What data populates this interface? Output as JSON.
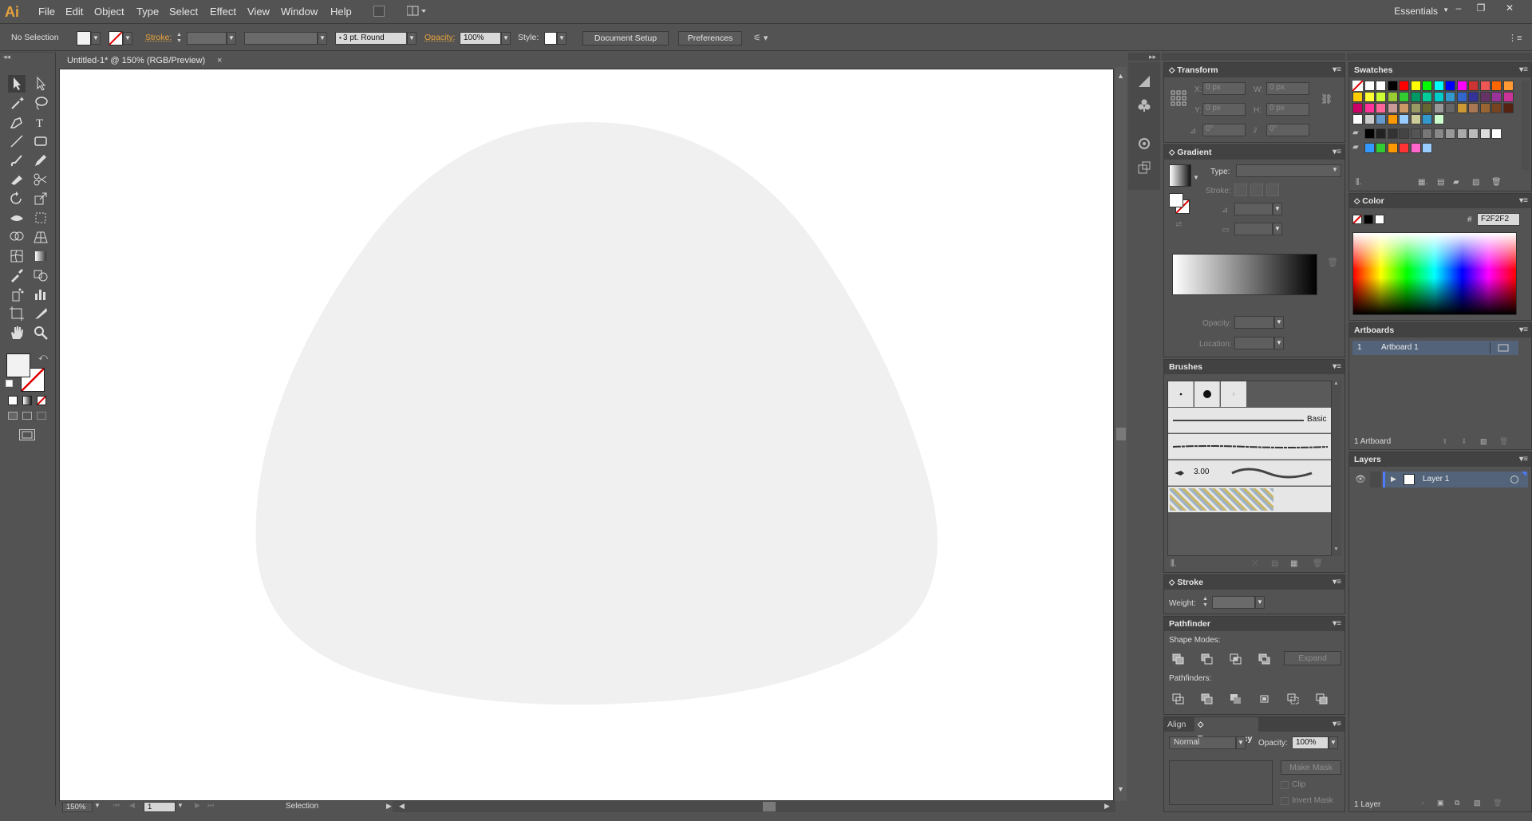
{
  "app": {
    "logo": "Ai",
    "workspace": "Essentials"
  },
  "menu": [
    "File",
    "Edit",
    "Object",
    "Type",
    "Select",
    "Effect",
    "View",
    "Window",
    "Help"
  ],
  "control": {
    "selection": "No Selection",
    "stroke_label": "Stroke:",
    "brush": "3 pt. Round",
    "opacity_label": "Opacity:",
    "opacity": "100%",
    "style_label": "Style:",
    "doc_setup": "Document Setup",
    "preferences": "Preferences"
  },
  "document": {
    "tab": "Untitled-1* @ 150% (RGB/Preview)",
    "tab_close": "×",
    "shape_fill": "#f0f0f0"
  },
  "status": {
    "zoom": "150%",
    "page": "1",
    "tool": "Selection"
  },
  "transform": {
    "title": "Transform",
    "x_label": "X:",
    "x": "0 px",
    "y_label": "Y:",
    "y": "0 px",
    "w_label": "W:",
    "w": "0 px",
    "h_label": "H:",
    "h": "0 px",
    "rotate": "0°",
    "shear": "0°"
  },
  "gradient": {
    "title": "Gradient",
    "type_label": "Type:",
    "stroke_label": "Stroke:",
    "opacity_label": "Opacity:",
    "location_label": "Location:"
  },
  "brushes": {
    "title": "Brushes",
    "basic": "Basic",
    "size": "3.00"
  },
  "stroke": {
    "title": "Stroke",
    "weight_label": "Weight:"
  },
  "pathfinder": {
    "title": "Pathfinder",
    "shape_modes": "Shape Modes:",
    "pathfinders": "Pathfinders:",
    "expand": "Expand"
  },
  "align": {
    "title": "Align"
  },
  "transparency": {
    "title": "Transparency",
    "mode": "Normal",
    "opacity_label": "Opacity:",
    "opacity": "100%",
    "make_mask": "Make Mask",
    "clip": "Clip",
    "invert_mask": "Invert Mask"
  },
  "swatches": {
    "title": "Swatches"
  },
  "color": {
    "title": "Color",
    "hash": "#",
    "hex": "F2F2F2"
  },
  "artboards": {
    "title": "Artboards",
    "row_num": "1",
    "row_name": "Artboard 1",
    "count": "1 Artboard"
  },
  "layers": {
    "title": "Layers",
    "layer_name": "Layer 1",
    "count": "1 Layer"
  },
  "colors": {
    "accent": "#e8a33d",
    "panel_bg": "#535353",
    "selected_row": "#52637a"
  }
}
